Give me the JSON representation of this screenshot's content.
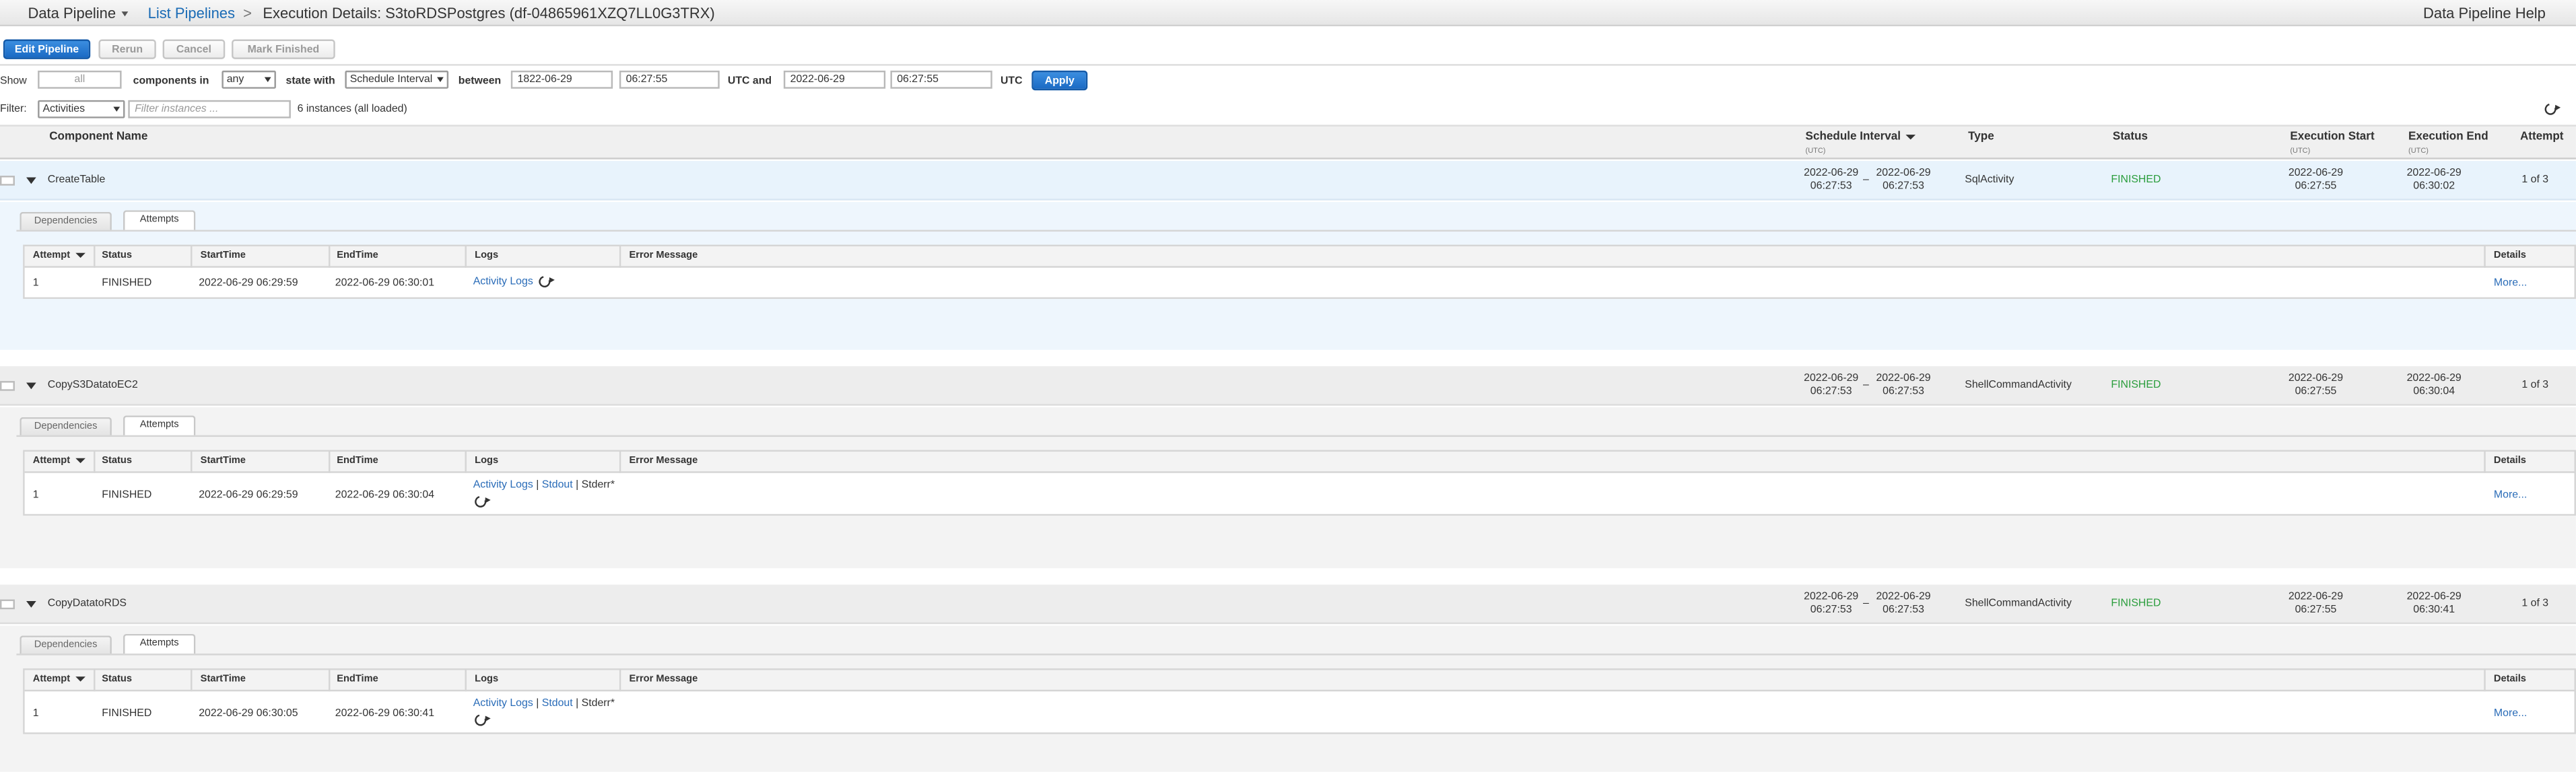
{
  "breadcrumb": {
    "service": "Data Pipeline",
    "list": "List Pipelines",
    "separator": ">",
    "current": "Execution Details: S3toRDSPostgres (df-04865961XZQ7LL0G3TRX)",
    "help": "Data Pipeline Help"
  },
  "toolbar": {
    "edit": "Edit Pipeline",
    "rerun": "Rerun",
    "cancel": "Cancel",
    "mark_finished": "Mark Finished"
  },
  "filters": {
    "show_label": "Show",
    "show_value": "all",
    "components_in_label": "components in",
    "components_in_value": "any",
    "state_with_label": "state with",
    "state_with_value": "Schedule Interval",
    "between_label": "between",
    "from_date": "1822-06-29",
    "from_time": "06:27:55",
    "utc_and": "UTC and",
    "to_date": "2022-06-29",
    "to_time": "06:27:55",
    "utc": "UTC",
    "apply": "Apply",
    "filter_label": "Filter:",
    "filter_type": "Activities",
    "filter_placeholder": "Filter instances ...",
    "instances_info": "6 instances (all loaded)"
  },
  "columns": {
    "component_name": "Component Name",
    "schedule_interval": "Schedule Interval",
    "schedule_sub": "(UTC)",
    "type": "Type",
    "status": "Status",
    "exec_start": "Execution Start",
    "exec_start_sub": "(UTC)",
    "exec_end": "Execution End",
    "exec_end_sub": "(UTC)",
    "attempt": "Attempt"
  },
  "tabs": {
    "dependencies": "Dependencies",
    "attempts": "Attempts"
  },
  "attempt_columns": {
    "attempt": "Attempt",
    "status": "Status",
    "start": "StartTime",
    "end": "EndTime",
    "logs": "Logs",
    "error": "Error Message",
    "details": "Details"
  },
  "components": [
    {
      "name": "CreateTable",
      "interval_from_date": "2022-06-29",
      "interval_from_time": "06:27:53",
      "interval_dash": "–",
      "interval_to_date": "2022-06-29",
      "interval_to_time": "06:27:53",
      "type": "SqlActivity",
      "status": "FINISHED",
      "start_date": "2022-06-29",
      "start_time": "06:27:55",
      "end_date": "2022-06-29",
      "end_time": "06:30:02",
      "attempt": "1 of 3",
      "attempts": [
        {
          "n": "1",
          "status": "FINISHED",
          "start": "2022-06-29 06:29:59",
          "end": "2022-06-29 06:30:01",
          "log_activity": "Activity Logs",
          "details": "More..."
        }
      ]
    },
    {
      "name": "CopyS3DatatoEC2",
      "interval_from_date": "2022-06-29",
      "interval_from_time": "06:27:53",
      "interval_dash": "–",
      "interval_to_date": "2022-06-29",
      "interval_to_time": "06:27:53",
      "type": "ShellCommandActivity",
      "status": "FINISHED",
      "start_date": "2022-06-29",
      "start_time": "06:27:55",
      "end_date": "2022-06-29",
      "end_time": "06:30:04",
      "attempt": "1 of 3",
      "attempts": [
        {
          "n": "1",
          "status": "FINISHED",
          "start": "2022-06-29 06:29:59",
          "end": "2022-06-29 06:30:04",
          "log_activity": "Activity Logs",
          "log_sep": "|",
          "log_stdout": "Stdout",
          "log_stderr": "Stderr*",
          "details": "More..."
        }
      ]
    },
    {
      "name": "CopyDatatoRDS",
      "interval_from_date": "2022-06-29",
      "interval_from_time": "06:27:53",
      "interval_dash": "–",
      "interval_to_date": "2022-06-29",
      "interval_to_time": "06:27:53",
      "type": "ShellCommandActivity",
      "status": "FINISHED",
      "start_date": "2022-06-29",
      "start_time": "06:27:55",
      "end_date": "2022-06-29",
      "end_time": "06:30:41",
      "attempt": "1 of 3",
      "attempts": [
        {
          "n": "1",
          "status": "FINISHED",
          "start": "2022-06-29 06:30:05",
          "end": "2022-06-29 06:30:41",
          "log_activity": "Activity Logs",
          "log_sep": "|",
          "log_stdout": "Stdout",
          "log_stderr": "Stderr*",
          "details": "More..."
        }
      ]
    }
  ]
}
